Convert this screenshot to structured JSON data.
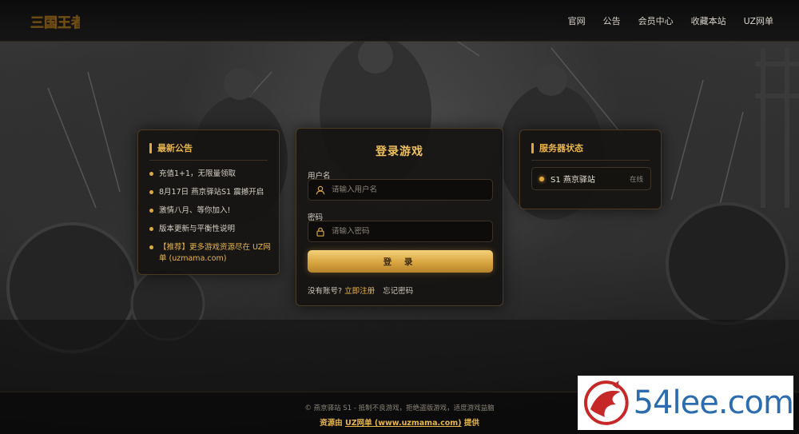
{
  "app": {
    "logo_text": "三国王者"
  },
  "nav": {
    "items": [
      "官网",
      "公告",
      "会员中心",
      "收藏本站",
      "UZ网单"
    ]
  },
  "notice": {
    "title": "最新公告",
    "items": [
      "充值1+1，无限量领取",
      "8月17日 燕京驿站S1 震撼开启",
      "激情八月、等你加入!",
      "版本更新与平衡性说明",
      "【推荐】更多游戏资源尽在 UZ网单 (uzmama.com)"
    ]
  },
  "login": {
    "title": "登录游戏",
    "username_label": "用户名",
    "username_placeholder": "请输入用户名",
    "password_label": "密码",
    "password_placeholder": "请输入密码",
    "submit_label": "登 录",
    "no_account_text": "没有账号?",
    "register_link": "立即注册",
    "forgot_link": "忘记密码"
  },
  "server": {
    "title": "服务器状态",
    "items": [
      {
        "name": "S1 燕京驿站",
        "status": "在线"
      }
    ]
  },
  "footer": {
    "copyright": "© 燕京驿站 S1 - 抵制不良游戏，拒绝盗版游戏，适度游戏益脑",
    "credit_prefix": "资源由",
    "credit_link": "UZ网单 (www.uzmama.com)",
    "credit_suffix": "提供"
  },
  "watermark": {
    "text_left": "54",
    "text_right": "lee.com"
  },
  "colors": {
    "accent_gold": "#e8b64a",
    "panel_border": "#4a3b22",
    "online_dot": "#e0a93a"
  },
  "icons": {
    "username": "user-icon",
    "password": "lock-icon"
  }
}
